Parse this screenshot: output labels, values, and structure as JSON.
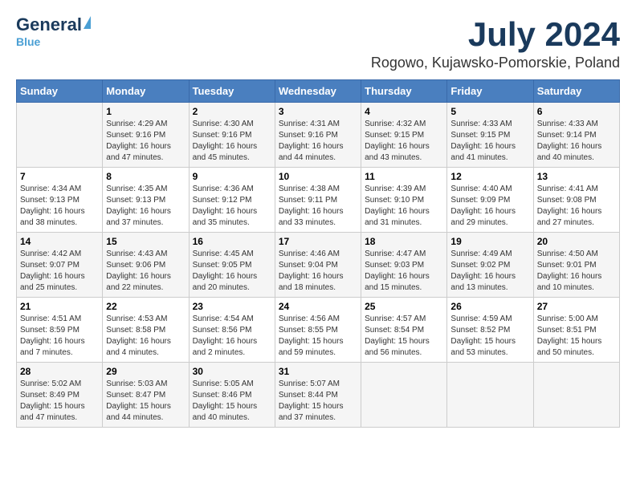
{
  "logo": {
    "general": "General",
    "blue": "Blue"
  },
  "title": "July 2024",
  "location": "Rogowo, Kujawsko-Pomorskie, Poland",
  "headers": [
    "Sunday",
    "Monday",
    "Tuesday",
    "Wednesday",
    "Thursday",
    "Friday",
    "Saturday"
  ],
  "weeks": [
    [
      {
        "day": "",
        "sunrise": "",
        "sunset": "",
        "daylight": ""
      },
      {
        "day": "1",
        "sunrise": "Sunrise: 4:29 AM",
        "sunset": "Sunset: 9:16 PM",
        "daylight": "Daylight: 16 hours and 47 minutes."
      },
      {
        "day": "2",
        "sunrise": "Sunrise: 4:30 AM",
        "sunset": "Sunset: 9:16 PM",
        "daylight": "Daylight: 16 hours and 45 minutes."
      },
      {
        "day": "3",
        "sunrise": "Sunrise: 4:31 AM",
        "sunset": "Sunset: 9:16 PM",
        "daylight": "Daylight: 16 hours and 44 minutes."
      },
      {
        "day": "4",
        "sunrise": "Sunrise: 4:32 AM",
        "sunset": "Sunset: 9:15 PM",
        "daylight": "Daylight: 16 hours and 43 minutes."
      },
      {
        "day": "5",
        "sunrise": "Sunrise: 4:33 AM",
        "sunset": "Sunset: 9:15 PM",
        "daylight": "Daylight: 16 hours and 41 minutes."
      },
      {
        "day": "6",
        "sunrise": "Sunrise: 4:33 AM",
        "sunset": "Sunset: 9:14 PM",
        "daylight": "Daylight: 16 hours and 40 minutes."
      }
    ],
    [
      {
        "day": "7",
        "sunrise": "Sunrise: 4:34 AM",
        "sunset": "Sunset: 9:13 PM",
        "daylight": "Daylight: 16 hours and 38 minutes."
      },
      {
        "day": "8",
        "sunrise": "Sunrise: 4:35 AM",
        "sunset": "Sunset: 9:13 PM",
        "daylight": "Daylight: 16 hours and 37 minutes."
      },
      {
        "day": "9",
        "sunrise": "Sunrise: 4:36 AM",
        "sunset": "Sunset: 9:12 PM",
        "daylight": "Daylight: 16 hours and 35 minutes."
      },
      {
        "day": "10",
        "sunrise": "Sunrise: 4:38 AM",
        "sunset": "Sunset: 9:11 PM",
        "daylight": "Daylight: 16 hours and 33 minutes."
      },
      {
        "day": "11",
        "sunrise": "Sunrise: 4:39 AM",
        "sunset": "Sunset: 9:10 PM",
        "daylight": "Daylight: 16 hours and 31 minutes."
      },
      {
        "day": "12",
        "sunrise": "Sunrise: 4:40 AM",
        "sunset": "Sunset: 9:09 PM",
        "daylight": "Daylight: 16 hours and 29 minutes."
      },
      {
        "day": "13",
        "sunrise": "Sunrise: 4:41 AM",
        "sunset": "Sunset: 9:08 PM",
        "daylight": "Daylight: 16 hours and 27 minutes."
      }
    ],
    [
      {
        "day": "14",
        "sunrise": "Sunrise: 4:42 AM",
        "sunset": "Sunset: 9:07 PM",
        "daylight": "Daylight: 16 hours and 25 minutes."
      },
      {
        "day": "15",
        "sunrise": "Sunrise: 4:43 AM",
        "sunset": "Sunset: 9:06 PM",
        "daylight": "Daylight: 16 hours and 22 minutes."
      },
      {
        "day": "16",
        "sunrise": "Sunrise: 4:45 AM",
        "sunset": "Sunset: 9:05 PM",
        "daylight": "Daylight: 16 hours and 20 minutes."
      },
      {
        "day": "17",
        "sunrise": "Sunrise: 4:46 AM",
        "sunset": "Sunset: 9:04 PM",
        "daylight": "Daylight: 16 hours and 18 minutes."
      },
      {
        "day": "18",
        "sunrise": "Sunrise: 4:47 AM",
        "sunset": "Sunset: 9:03 PM",
        "daylight": "Daylight: 16 hours and 15 minutes."
      },
      {
        "day": "19",
        "sunrise": "Sunrise: 4:49 AM",
        "sunset": "Sunset: 9:02 PM",
        "daylight": "Daylight: 16 hours and 13 minutes."
      },
      {
        "day": "20",
        "sunrise": "Sunrise: 4:50 AM",
        "sunset": "Sunset: 9:01 PM",
        "daylight": "Daylight: 16 hours and 10 minutes."
      }
    ],
    [
      {
        "day": "21",
        "sunrise": "Sunrise: 4:51 AM",
        "sunset": "Sunset: 8:59 PM",
        "daylight": "Daylight: 16 hours and 7 minutes."
      },
      {
        "day": "22",
        "sunrise": "Sunrise: 4:53 AM",
        "sunset": "Sunset: 8:58 PM",
        "daylight": "Daylight: 16 hours and 4 minutes."
      },
      {
        "day": "23",
        "sunrise": "Sunrise: 4:54 AM",
        "sunset": "Sunset: 8:56 PM",
        "daylight": "Daylight: 16 hours and 2 minutes."
      },
      {
        "day": "24",
        "sunrise": "Sunrise: 4:56 AM",
        "sunset": "Sunset: 8:55 PM",
        "daylight": "Daylight: 15 hours and 59 minutes."
      },
      {
        "day": "25",
        "sunrise": "Sunrise: 4:57 AM",
        "sunset": "Sunset: 8:54 PM",
        "daylight": "Daylight: 15 hours and 56 minutes."
      },
      {
        "day": "26",
        "sunrise": "Sunrise: 4:59 AM",
        "sunset": "Sunset: 8:52 PM",
        "daylight": "Daylight: 15 hours and 53 minutes."
      },
      {
        "day": "27",
        "sunrise": "Sunrise: 5:00 AM",
        "sunset": "Sunset: 8:51 PM",
        "daylight": "Daylight: 15 hours and 50 minutes."
      }
    ],
    [
      {
        "day": "28",
        "sunrise": "Sunrise: 5:02 AM",
        "sunset": "Sunset: 8:49 PM",
        "daylight": "Daylight: 15 hours and 47 minutes."
      },
      {
        "day": "29",
        "sunrise": "Sunrise: 5:03 AM",
        "sunset": "Sunset: 8:47 PM",
        "daylight": "Daylight: 15 hours and 44 minutes."
      },
      {
        "day": "30",
        "sunrise": "Sunrise: 5:05 AM",
        "sunset": "Sunset: 8:46 PM",
        "daylight": "Daylight: 15 hours and 40 minutes."
      },
      {
        "day": "31",
        "sunrise": "Sunrise: 5:07 AM",
        "sunset": "Sunset: 8:44 PM",
        "daylight": "Daylight: 15 hours and 37 minutes."
      },
      {
        "day": "",
        "sunrise": "",
        "sunset": "",
        "daylight": ""
      },
      {
        "day": "",
        "sunrise": "",
        "sunset": "",
        "daylight": ""
      },
      {
        "day": "",
        "sunrise": "",
        "sunset": "",
        "daylight": ""
      }
    ]
  ]
}
